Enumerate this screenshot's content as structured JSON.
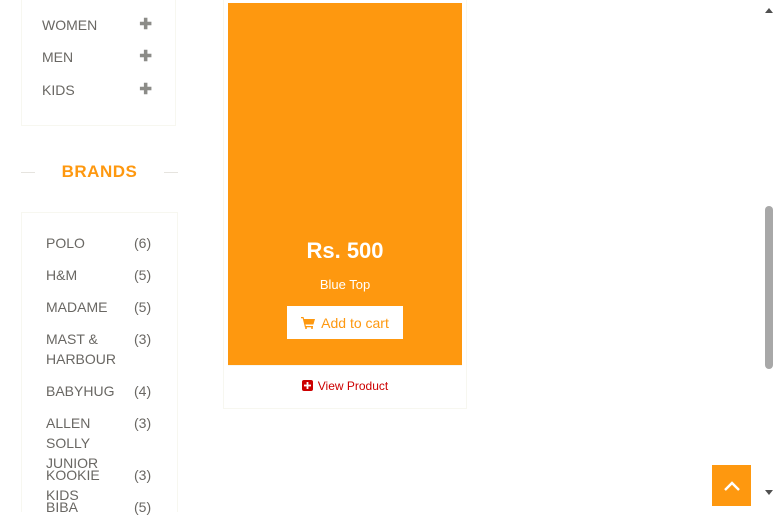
{
  "categories": [
    {
      "label": "WOMEN",
      "toggle_icon": "plus-icon"
    },
    {
      "label": "MEN",
      "toggle_icon": "plus-icon"
    },
    {
      "label": "KIDS",
      "toggle_icon": "plus-icon"
    }
  ],
  "brands": {
    "title": "BRANDS",
    "items": [
      {
        "name": "POLO",
        "count": "(6)"
      },
      {
        "name": "H&M",
        "count": "(5)"
      },
      {
        "name": "MADAME",
        "count": "(5)"
      },
      {
        "name": "MAST & HARBOUR",
        "count": "(3)"
      },
      {
        "name": "BABYHUG",
        "count": "(4)"
      },
      {
        "name": "ALLEN SOLLY JUNIOR",
        "count": "(3)"
      },
      {
        "name": "KOOKIE KIDS",
        "count": "(3)"
      },
      {
        "name": "BIBA",
        "count": "(5)"
      }
    ]
  },
  "product": {
    "price": "Rs. 500",
    "name": "Blue Top",
    "add_to_cart": "Add to cart",
    "view_product": "View Product"
  },
  "colors": {
    "accent": "#fe980f",
    "text": "#696763",
    "muted": "#b3afa8"
  }
}
